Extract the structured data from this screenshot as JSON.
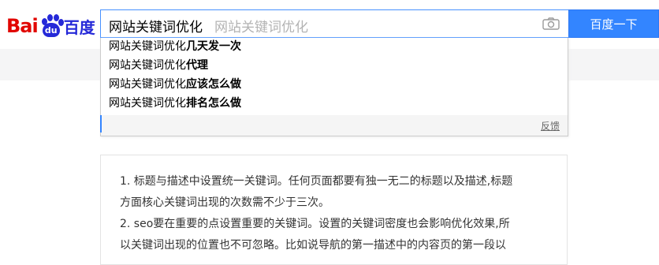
{
  "logo": {
    "part1": "Bai",
    "part2": "du",
    "part3": "百度"
  },
  "search": {
    "value": "网站关键词优化",
    "placeholder": "网站关键词优化",
    "button_label": "百度一下"
  },
  "suggestions": [
    {
      "prefix": "网站关键词优化",
      "bold": "几天发一次"
    },
    {
      "prefix": "网站关键词优化",
      "bold": "代理"
    },
    {
      "prefix": "网站关键词优化",
      "bold": "应该怎么做"
    },
    {
      "prefix": "网站关键词优化",
      "bold": "排名怎么做"
    }
  ],
  "feedback_label": "反馈",
  "content": {
    "line1": "1. 标题与描述中设置统一关键词。任何页面都要有独一无二的标题以及描述,标题",
    "line2": "方面核心关键词出现的次数需不少于三次。",
    "line3": "2. seo要在重要的点设置重要的关键词。设置的关键词密度也会影响优化效果,所",
    "line4": "以关键词出现的位置也不可忽略。比如说导航的第一描述中的内容页的第一段以"
  },
  "colors": {
    "accent": "#3385ff",
    "brand_red": "#e10601",
    "brand_blue": "#2529d8"
  }
}
